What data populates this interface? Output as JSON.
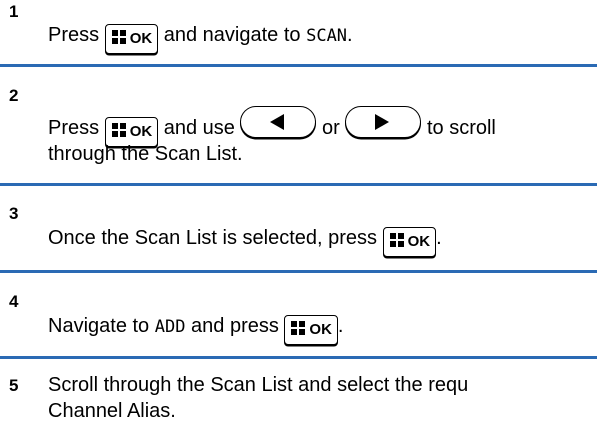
{
  "steps": [
    {
      "number": "1",
      "parts": [
        "Press",
        "and navigate to",
        "SCAN",
        "."
      ]
    },
    {
      "number": "2",
      "line1": [
        "Press",
        "and use",
        "or",
        "to scroll"
      ],
      "line2": "through the Scan List."
    },
    {
      "number": "3",
      "parts": [
        "Once the Scan List is selected, press",
        "."
      ]
    },
    {
      "number": "4",
      "parts": [
        "Navigate to",
        "ADD",
        "and press",
        "."
      ]
    },
    {
      "number": "5",
      "line1": "Scroll through the Scan List and select the requ",
      "line2": "Channel Alias."
    }
  ],
  "keys": {
    "ok_label": "OK",
    "menu_ok_icon": "menu-ok-key-icon",
    "left_icon": "left-navigation-key-icon",
    "right_icon": "right-navigation-key-icon"
  },
  "colors": {
    "divider": "#2a6ab4"
  }
}
